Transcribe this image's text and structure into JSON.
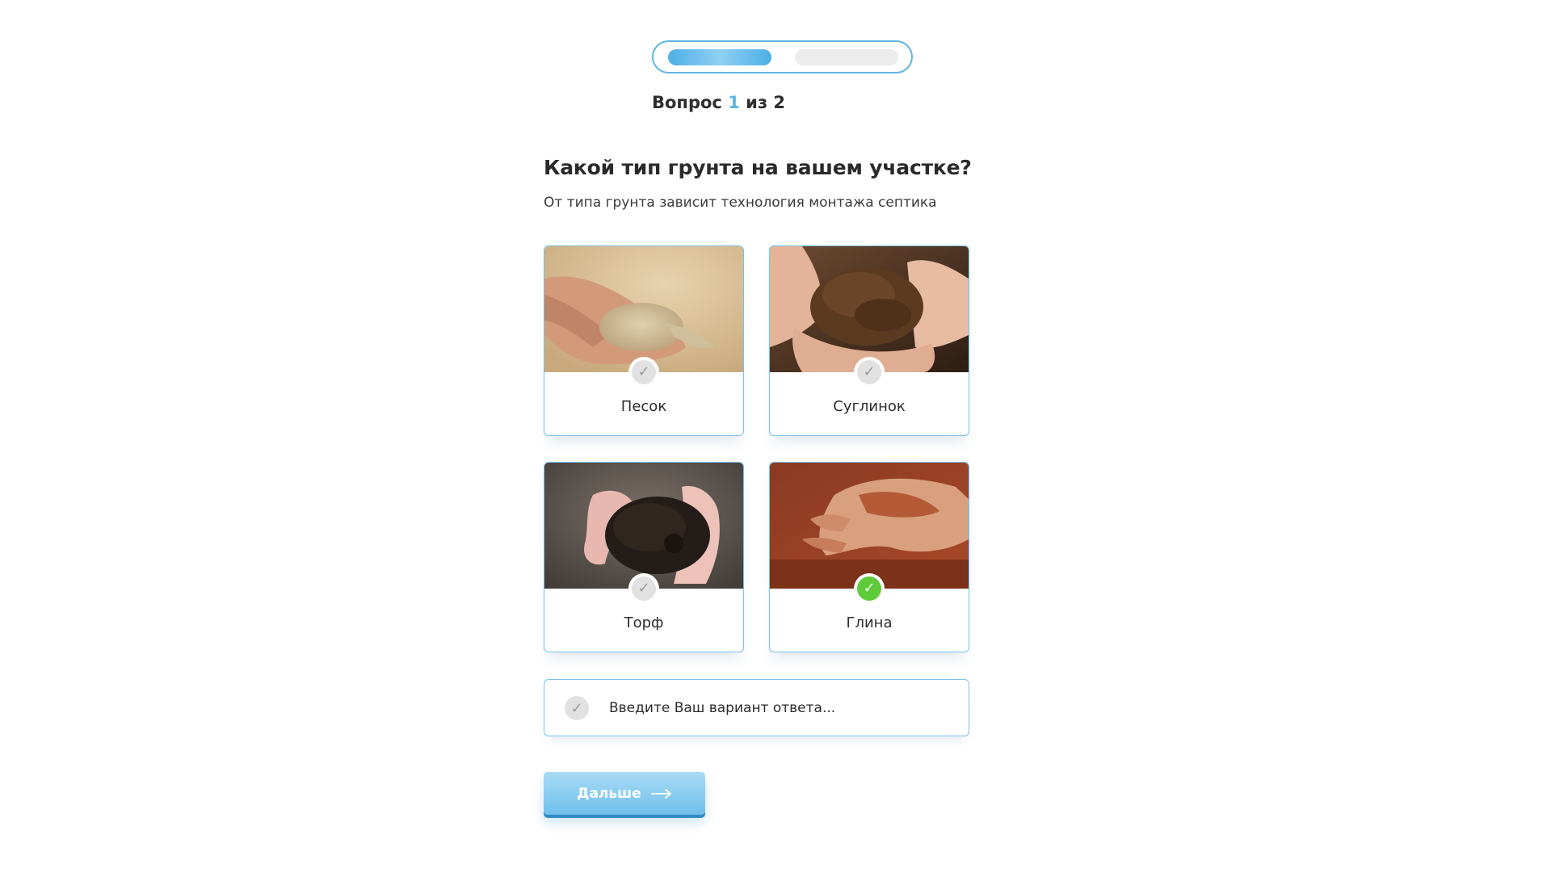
{
  "progress": {
    "current": 1,
    "total": 2
  },
  "counter": {
    "prefix": "Вопрос",
    "current": "1",
    "middle": "из",
    "total": "2"
  },
  "question": {
    "title": "Какой тип грунта на вашем участке?",
    "subtitle": "От типа грунта зависит технология монтажа септика"
  },
  "options": [
    {
      "label": "Песок",
      "selected": false,
      "image": "hand-with-sand"
    },
    {
      "label": "Суглинок",
      "selected": false,
      "image": "hands-with-loam"
    },
    {
      "label": "Торф",
      "selected": false,
      "image": "hands-with-peat"
    },
    {
      "label": "Глина",
      "selected": true,
      "image": "hand-with-clay"
    }
  ],
  "custom_answer": {
    "placeholder": "Введите Ваш вариант ответа...",
    "value": ""
  },
  "next_button": {
    "label": "Дальше"
  },
  "colors": {
    "accent": "#5bb5e6",
    "selected": "#5ecb3b",
    "border": "#78c2ec"
  },
  "icons": {
    "check": "check-icon",
    "arrow": "arrow-right-icon"
  }
}
